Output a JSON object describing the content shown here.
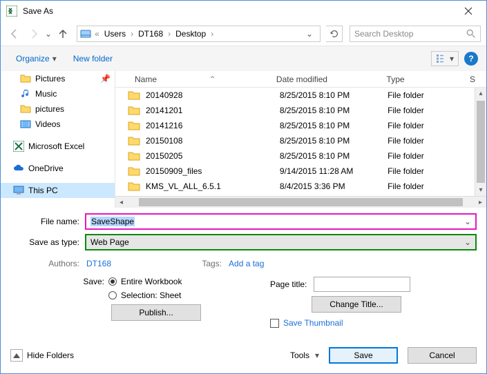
{
  "titlebar": {
    "title": "Save As"
  },
  "nav": {
    "crumbs": [
      "Users",
      "DT168",
      "Desktop"
    ],
    "search_placeholder": "Search Desktop"
  },
  "toolbar": {
    "organize": "Organize",
    "newfolder": "New folder"
  },
  "sidebar": {
    "items": [
      {
        "label": "Pictures",
        "icon": "folder",
        "pinned": true
      },
      {
        "label": "Music",
        "icon": "music"
      },
      {
        "label": "pictures",
        "icon": "folder"
      },
      {
        "label": "Videos",
        "icon": "video"
      }
    ],
    "excel": "Microsoft Excel",
    "onedrive": "OneDrive",
    "thispc": "This PC"
  },
  "columns": {
    "name": "Name",
    "date": "Date modified",
    "type": "Type",
    "size": "S"
  },
  "files": [
    {
      "name": "20140928",
      "date": "8/25/2015 8:10 PM",
      "type": "File folder"
    },
    {
      "name": "20141201",
      "date": "8/25/2015 8:10 PM",
      "type": "File folder"
    },
    {
      "name": "20141216",
      "date": "8/25/2015 8:10 PM",
      "type": "File folder"
    },
    {
      "name": "20150108",
      "date": "8/25/2015 8:10 PM",
      "type": "File folder"
    },
    {
      "name": "20150205",
      "date": "8/25/2015 8:10 PM",
      "type": "File folder"
    },
    {
      "name": "20150909_files",
      "date": "9/14/2015 11:28 AM",
      "type": "File folder"
    },
    {
      "name": "KMS_VL_ALL_6.5.1",
      "date": "8/4/2015 3:36 PM",
      "type": "File folder"
    }
  ],
  "form": {
    "filename_label": "File name:",
    "filename_value": "SaveShape",
    "type_label": "Save as type:",
    "type_value": "Web Page",
    "authors_label": "Authors:",
    "authors_value": "DT168",
    "tags_label": "Tags:",
    "tags_value": "Add a tag",
    "save_label": "Save:",
    "radio_workbook": "Entire Workbook",
    "radio_selection": "Selection: Sheet",
    "publish": "Publish...",
    "pagetitle_label": "Page title:",
    "change_title": "Change Title...",
    "save_thumbnail": "Save Thumbnail"
  },
  "footer": {
    "hide_folders": "Hide Folders",
    "tools": "Tools",
    "save": "Save",
    "cancel": "Cancel"
  }
}
